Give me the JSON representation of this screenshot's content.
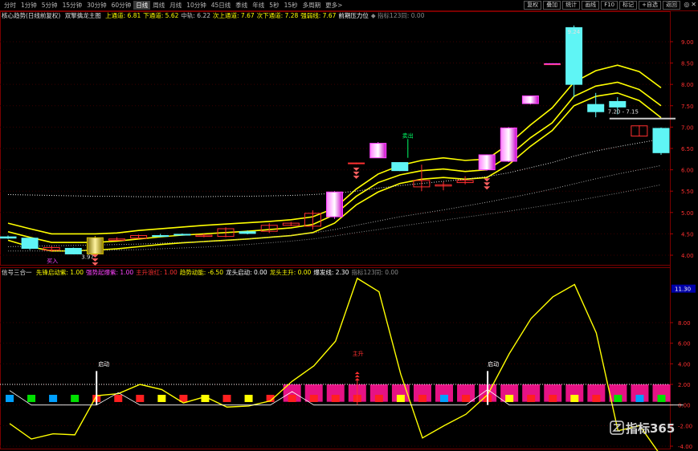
{
  "tabs": [
    "分时",
    "1分钟",
    "5分钟",
    "15分钟",
    "30分钟",
    "60分钟",
    "日线",
    "周线",
    "月线",
    "10分钟",
    "45日线",
    "季线",
    "年线",
    "5秒",
    "15秒",
    "多周期",
    "更多>"
  ],
  "active_tab": "日线",
  "right_buttons": [
    "复权",
    "叠加",
    "统计",
    "画线",
    "F10",
    "标记",
    "+自选",
    "返回"
  ],
  "window_controls": [
    "◎",
    "✕"
  ],
  "main_legend": {
    "name": "核心趋势(日线前复权)",
    "indicator": "双擎擒龙主图",
    "items": [
      {
        "text": "上通道: 6.81",
        "color": "#ffff00"
      },
      {
        "text": "下通道: 5.62",
        "color": "#ffff00"
      },
      {
        "text": "中轨: 6.22",
        "color": "#c8c8c8"
      },
      {
        "text": "次上通道: 7.67",
        "color": "#ffff00"
      },
      {
        "text": "次下通道: 7.28",
        "color": "#ffff00"
      },
      {
        "text": "强弱线: 7.67",
        "color": "#ffff00"
      },
      {
        "text": "前期压力位",
        "color": "#ffffff"
      },
      {
        "text": "◆ 指标123同: 0.00",
        "color": "#888888"
      }
    ]
  },
  "sub_legend": {
    "name": "信号三合一",
    "items": [
      {
        "text": "先锋启动紫: 1.00",
        "color": "#ffff00"
      },
      {
        "text": "强势起爆紫: 1.00",
        "color": "#ff44ff"
      },
      {
        "text": "主升浪红: 1.00",
        "color": "#ff3030"
      },
      {
        "text": "趋势动能: -6.50",
        "color": "#ffff00"
      },
      {
        "text": "龙头启动: 0.00",
        "color": "#ffffff"
      },
      {
        "text": "龙头主升: 0.00",
        "color": "#ffff00"
      },
      {
        "text": "爆发线: 2.30",
        "color": "#ffffff"
      },
      {
        "text": "指标123同: 0.00",
        "color": "#888888"
      }
    ]
  },
  "main_axis_ticks": [
    "9.00",
    "8.50",
    "8.00",
    "7.50",
    "7.00",
    "6.50",
    "6.00",
    "5.50",
    "5.00",
    "4.50",
    "4.00"
  ],
  "sub_axis_ticks": [
    "8.00",
    "6.00",
    "4.00",
    "2.00",
    "0.00",
    "-2.00",
    "-4.00"
  ],
  "sub_axis_marker": "11.30",
  "annotations": {
    "high_price": "9.24",
    "low_price": "3.97",
    "resistance_label": "7.20 - 7.15",
    "buy_label": "买入",
    "sell_label": "卖出",
    "start_label_1": "启动",
    "start_label_2": "启动",
    "main_rise_label": "主升"
  },
  "watermark": "指标365",
  "colors": {
    "up": "#ff3030",
    "down_fill": "#5ff5f5",
    "channel": "#ffff00",
    "midline": "#b0b0b0",
    "magenta": "#ff44ff"
  },
  "chart_data": [
    {
      "type": "candlestick",
      "title": "双擎擒龙主图",
      "ylim": [
        3.85,
        9.45
      ],
      "candles": [
        {
          "o": 4.43,
          "h": 4.46,
          "l": 4.38,
          "c": 4.4,
          "s": "down"
        },
        {
          "o": 4.4,
          "h": 4.42,
          "l": 4.12,
          "c": 4.16,
          "s": "down"
        },
        {
          "o": 4.12,
          "h": 4.22,
          "l": 4.08,
          "c": 4.18,
          "s": "up"
        },
        {
          "o": 4.16,
          "h": 4.18,
          "l": 4.02,
          "c": 4.03,
          "s": "down"
        },
        {
          "o": 4.03,
          "h": 4.45,
          "l": 3.97,
          "c": 4.41,
          "s": "gold"
        },
        {
          "o": 4.35,
          "h": 4.42,
          "l": 4.34,
          "c": 4.38,
          "s": "up"
        },
        {
          "o": 4.4,
          "h": 4.48,
          "l": 4.38,
          "c": 4.46,
          "s": "up"
        },
        {
          "o": 4.46,
          "h": 4.5,
          "l": 4.42,
          "c": 4.44,
          "s": "down"
        },
        {
          "o": 4.48,
          "h": 4.51,
          "l": 4.46,
          "c": 4.49,
          "s": "down"
        },
        {
          "o": 4.44,
          "h": 4.5,
          "l": 4.42,
          "c": 4.47,
          "s": "up"
        },
        {
          "o": 4.44,
          "h": 4.65,
          "l": 4.42,
          "c": 4.62,
          "s": "up"
        },
        {
          "o": 4.55,
          "h": 4.58,
          "l": 4.49,
          "c": 4.51,
          "s": "down"
        },
        {
          "o": 4.56,
          "h": 4.75,
          "l": 4.52,
          "c": 4.7,
          "s": "up"
        },
        {
          "o": 4.7,
          "h": 4.78,
          "l": 4.68,
          "c": 4.75,
          "s": "up"
        },
        {
          "o": 4.68,
          "h": 5.05,
          "l": 4.6,
          "c": 4.98,
          "s": "up"
        },
        {
          "o": 4.9,
          "h": 5.5,
          "l": 4.85,
          "c": 5.48,
          "s": "magenta"
        },
        {
          "o": 6.16,
          "h": 6.17,
          "l": 6.13,
          "c": 6.15,
          "s": "flat"
        },
        {
          "o": 6.28,
          "h": 6.65,
          "l": 6.28,
          "c": 6.62,
          "s": "magenta"
        },
        {
          "o": 6.17,
          "h": 6.18,
          "l": 5.97,
          "c": 5.98,
          "s": "down"
        },
        {
          "o": 5.75,
          "h": 6.12,
          "l": 5.5,
          "c": 5.6,
          "s": "up"
        },
        {
          "o": 5.65,
          "h": 5.72,
          "l": 5.52,
          "c": 5.62,
          "s": "up"
        },
        {
          "o": 5.75,
          "h": 5.85,
          "l": 5.66,
          "c": 5.7,
          "s": "up"
        },
        {
          "o": 6.35,
          "h": 6.36,
          "l": 5.98,
          "c": 6.0,
          "s": "magenta"
        },
        {
          "o": 6.2,
          "h": 7.0,
          "l": 6.18,
          "c": 6.98,
          "s": "magenta"
        },
        {
          "o": 7.55,
          "h": 7.74,
          "l": 7.53,
          "c": 7.73,
          "s": "magenta"
        },
        {
          "o": 8.48,
          "h": 8.49,
          "l": 8.47,
          "c": 8.48,
          "s": "flat"
        },
        {
          "o": 9.33,
          "h": 9.38,
          "l": 7.7,
          "c": 8.0,
          "s": "down"
        },
        {
          "o": 7.53,
          "h": 7.8,
          "l": 7.23,
          "c": 7.36,
          "s": "down"
        },
        {
          "o": 7.6,
          "h": 7.7,
          "l": 7.3,
          "c": 7.47,
          "s": "down"
        },
        {
          "o": 7.03,
          "h": 7.04,
          "l": 6.78,
          "c": 6.79,
          "s": "up"
        },
        {
          "o": 6.97,
          "h": 6.99,
          "l": 6.35,
          "c": 6.4,
          "s": "down"
        }
      ],
      "lines": [
        {
          "name": "上通道",
          "color": "#ffff00",
          "values": [
            4.75,
            4.62,
            4.5,
            4.5,
            4.5,
            4.52,
            4.58,
            4.62,
            4.66,
            4.7,
            4.73,
            4.76,
            4.79,
            4.83,
            4.9,
            5.1,
            5.55,
            5.9,
            6.1,
            6.22,
            6.28,
            6.22,
            6.25,
            6.6,
            7.05,
            7.45,
            8.05,
            8.32,
            8.45,
            8.3,
            7.92
          ]
        },
        {
          "name": "次上通道",
          "color": "#ffff00",
          "values": [
            4.55,
            4.42,
            4.3,
            4.3,
            4.3,
            4.33,
            4.38,
            4.43,
            4.47,
            4.5,
            4.53,
            4.56,
            4.6,
            4.64,
            4.72,
            4.95,
            5.38,
            5.7,
            5.88,
            5.98,
            6.02,
            5.96,
            6.0,
            6.32,
            6.75,
            7.1,
            7.72,
            7.96,
            8.05,
            7.88,
            7.5
          ]
        },
        {
          "name": "下通道",
          "color": "#ffff00",
          "values": [
            4.35,
            4.2,
            4.1,
            4.1,
            4.12,
            4.15,
            4.2,
            4.25,
            4.29,
            4.32,
            4.35,
            4.38,
            4.42,
            4.46,
            4.53,
            4.75,
            5.18,
            5.48,
            5.68,
            5.78,
            5.82,
            5.78,
            5.82,
            6.12,
            6.55,
            6.92,
            7.5,
            7.72,
            7.8,
            7.62,
            7.22
          ]
        },
        {
          "name": "中轨",
          "color": "#e0e0e0",
          "dotted": true,
          "values": [
            5.42,
            5.41,
            5.4,
            5.39,
            5.38,
            5.38,
            5.37,
            5.37,
            5.37,
            5.37,
            5.38,
            5.38,
            5.39,
            5.4,
            5.42,
            5.45,
            5.5,
            5.57,
            5.63,
            5.68,
            5.73,
            5.78,
            5.84,
            5.93,
            6.05,
            6.17,
            6.32,
            6.44,
            6.54,
            6.63,
            6.72
          ]
        },
        {
          "name": "",
          "color": "#a8a8a8",
          "dotted": true,
          "values": [
            4.2,
            4.21,
            4.22,
            4.23,
            4.24,
            4.25,
            4.26,
            4.28,
            4.3,
            4.32,
            4.35,
            4.38,
            4.42,
            4.46,
            4.52,
            4.6,
            4.7,
            4.8,
            4.9,
            4.98,
            5.06,
            5.15,
            5.24,
            5.34,
            5.44,
            5.55,
            5.67,
            5.79,
            5.9,
            6.0,
            6.1
          ]
        },
        {
          "name": "",
          "color": "#8a8a8a",
          "dotted": true,
          "values": [
            4.1,
            4.1,
            4.1,
            4.1,
            4.11,
            4.12,
            4.13,
            4.15,
            4.17,
            4.19,
            4.22,
            4.25,
            4.29,
            4.33,
            4.38,
            4.45,
            4.53,
            4.6,
            4.68,
            4.75,
            4.82,
            4.89,
            4.96,
            5.03,
            5.11,
            5.19,
            5.27,
            5.36,
            5.45,
            5.55,
            5.65
          ]
        }
      ],
      "resistance": {
        "from_index": 28,
        "to_index": 30,
        "value": 7.2
      }
    },
    {
      "type": "line",
      "title": "信号三合一",
      "ylim": [
        -4.0,
        12.6
      ],
      "series": [
        {
          "name": "趋势动能",
          "color": "#ffff00",
          "values": [
            -1.8,
            -3.3,
            -2.8,
            -2.9,
            0.9,
            1.1,
            2.0,
            1.5,
            0.2,
            0.8,
            -0.2,
            -0.1,
            0.4,
            2.3,
            3.8,
            6.2,
            12.3,
            11.0,
            3.0,
            -3.2,
            -2.0,
            -0.9,
            1.0,
            5.0,
            8.4,
            10.5,
            11.7,
            7.0,
            -2.5,
            -2.0,
            -5.0,
            -5.8
          ]
        },
        {
          "name": "爆发线",
          "color": "#ffffff",
          "values": [
            1.4,
            0.0,
            0.0,
            0.0,
            0.0,
            1.2,
            0.0,
            0.0,
            0.0,
            0.0,
            0.0,
            0.0,
            0.0,
            1.3,
            0.0,
            0.0,
            0.0,
            0.0,
            0.0,
            0.0,
            0.0,
            0.0,
            1.5,
            0.0,
            0.0,
            0.0,
            0.0,
            0.0,
            0.0,
            0.0,
            0.0,
            0.0
          ]
        }
      ],
      "signal_row": [
        "#00a0ff",
        "#00e000",
        "#00a0ff",
        "#00e000",
        "#ff2020",
        "#ff2020",
        "#ff2020",
        "#ffff00",
        "#ff2020",
        "#ffff00",
        "#ff2020",
        "#ffff00",
        "#ff2020",
        "#ff2020",
        "#ff2020",
        "#ff2020",
        "#ff2020",
        "#ff2020",
        "#ffff00",
        "#ff2020",
        "#00a0ff",
        "#ff2020",
        "#ff2020",
        "#ffff00",
        "#ff2020",
        "#ff2020",
        "#ffff00",
        "#ff2020",
        "#00e000",
        "#00a0ff",
        "#00e000"
      ],
      "magenta_blocks_from": 13
    }
  ]
}
